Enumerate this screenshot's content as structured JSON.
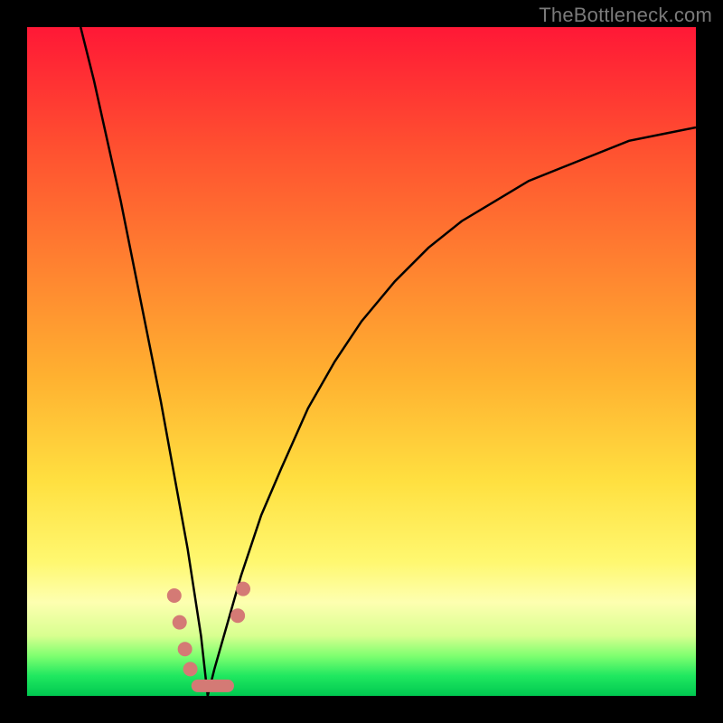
{
  "watermark": "TheBottleneck.com",
  "colors": {
    "curve": "#000000",
    "marker": "#d47a75",
    "gradient_top": "#ff1836",
    "gradient_bottom": "#00c850",
    "frame": "#000000"
  },
  "chart_data": {
    "type": "line",
    "title": "",
    "xlabel": "",
    "ylabel": "",
    "xlim": [
      0,
      100
    ],
    "ylim": [
      0,
      100
    ],
    "grid": false,
    "legend": false,
    "comment": "Curve is a V-shaped bottleneck plot. y values are approximate percentage height read off the image (0 = bottom/green, 100 = top/red). Minimum at x≈27.",
    "x": [
      8,
      10,
      12,
      14,
      16,
      18,
      20,
      22,
      24,
      26,
      27,
      28,
      30,
      32,
      35,
      38,
      42,
      46,
      50,
      55,
      60,
      65,
      70,
      75,
      80,
      85,
      90,
      95,
      100
    ],
    "y": [
      100,
      92,
      83,
      74,
      64,
      54,
      44,
      33,
      22,
      9,
      0,
      4,
      11,
      18,
      27,
      34,
      43,
      50,
      56,
      62,
      67,
      71,
      74,
      77,
      79,
      81,
      83,
      84,
      85
    ],
    "markers": {
      "comment": "Salmon dots and bar visible near the valley; positions approximate in chart-domain units.",
      "points": [
        {
          "x": 22.0,
          "y": 15
        },
        {
          "x": 22.8,
          "y": 11
        },
        {
          "x": 23.6,
          "y": 7
        },
        {
          "x": 24.4,
          "y": 4
        },
        {
          "x": 31.5,
          "y": 12
        },
        {
          "x": 32.3,
          "y": 16
        }
      ],
      "bar": {
        "x0": 25.5,
        "x1": 30.0,
        "y": 1.5
      }
    }
  }
}
